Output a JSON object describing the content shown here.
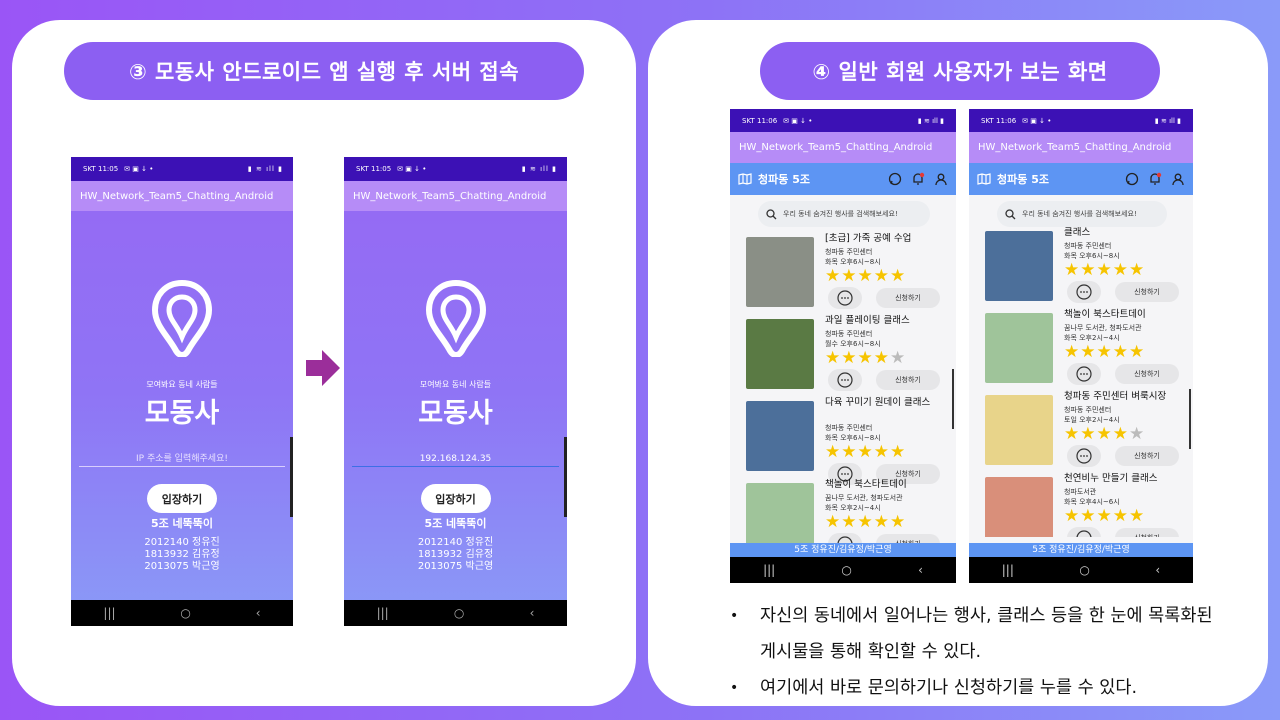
{
  "left_panel": {
    "heading": "③ 모동사 안드로이드 앱 실행 후 서버 접속",
    "phones": [
      {
        "status_time": "SKT 11:05",
        "app_title": "HW_Network_Team5_Chatting_Android",
        "tagline": "모여봐요 동네 사람들",
        "app_name": "모동사",
        "ip_input": "",
        "ip_placeholder": "IP 주소를 입력해주세요!",
        "enter_button": "입장하기",
        "team_name": "5조 네뚝뚝이",
        "members": [
          "2012140 정유진",
          "1813932 김유정",
          "2013075 박근영"
        ]
      },
      {
        "status_time": "SKT 11:05",
        "app_title": "HW_Network_Team5_Chatting_Android",
        "tagline": "모여봐요 동네 사람들",
        "app_name": "모동사",
        "ip_input": "192.168.124.35",
        "ip_placeholder": "",
        "enter_button": "입장하기",
        "team_name": "5조 네뚝뚝이",
        "members": [
          "2012140 정유진",
          "1813932 김유정",
          "2013075 박근영"
        ]
      }
    ]
  },
  "right_panel": {
    "heading": "④ 일반 회원 사용자가 보는 화면",
    "phones": [
      {
        "status_time": "SKT 11:06",
        "app_title": "HW_Network_Team5_Chatting_Android",
        "location": "청파동 5조",
        "search_placeholder": "우리 동네 숨겨진 행사를 검색해보세요!",
        "items": [
          {
            "title": "[초급] 가죽 공예 수업",
            "place": "청파동 주민센터",
            "time": "화목 오후6시~8시",
            "rating": 5,
            "apply": "신청하기",
            "thumb_color": "#8a8f86"
          },
          {
            "title": "과일 플레이팅 클래스",
            "place": "청파동 주민센터",
            "time": "월수 오후6시~8시",
            "rating": 4,
            "apply": "신청하기",
            "thumb_color": "#5a7a44"
          },
          {
            "title": "다육 꾸미기 원데이 클래스",
            "place": "청파동 주민센터",
            "time": "화목 오후6시~8시",
            "rating": 5,
            "apply": "신청하기",
            "thumb_color": "#4c6f9a"
          },
          {
            "title": "책놀이 북스타트데이",
            "place": "꿈나무 도서관, 청파도서관",
            "time": "화목 오후2시~4시",
            "rating": 5,
            "apply": "신청하기",
            "thumb_color": "#9fc49a"
          }
        ],
        "footer": "5조 정유진/김유정/박근영"
      },
      {
        "status_time": "SKT 11:06",
        "app_title": "HW_Network_Team5_Chatting_Android",
        "location": "청파동 5조",
        "search_placeholder": "우리 동네 숨겨진 행사를 검색해보세요!",
        "items": [
          {
            "title": "클래스",
            "place": "청파동 주민센터",
            "time": "화목 오후6시~8시",
            "rating": 5,
            "apply": "신청하기",
            "thumb_color": "#4c6f9a"
          },
          {
            "title": "책놀이 북스타트데이",
            "place": "꿈나무 도서관, 청파도서관",
            "time": "화목 오후2시~4시",
            "rating": 5,
            "apply": "신청하기",
            "thumb_color": "#9fc49a"
          },
          {
            "title": "청파동 주민센터 벼룩시장",
            "place": "청파동 주민센터",
            "time": "토일 오후2시~4시",
            "rating": 4,
            "apply": "신청하기",
            "thumb_color": "#e8d48a"
          },
          {
            "title": "천연비누 만들기 클래스",
            "place": "청파도서관",
            "time": "화목 오후4시~6시",
            "rating": 5,
            "apply": "신청하기",
            "thumb_color": "#d98f7a"
          }
        ],
        "footer": "5조 정유진/김유정/박근영"
      }
    ],
    "bullets": [
      "자신의 동네에서 일어나는 행사, 클래스 등을 한 눈에 목록화된 게시물을 통해 확인할 수 있다.",
      "여기에서 바로 문의하기나 신청하기를 누를 수 있다."
    ]
  },
  "colors": {
    "accent_purple": "#8c5ff2",
    "status_bar": "#3c11b5",
    "app_bar": "#b68cf7",
    "top_bar_blue": "#5d95f3",
    "star": "#f6c400",
    "arrow": "#9b2e9a"
  },
  "icons": [
    "map-icon",
    "chat-icon",
    "bell-icon",
    "user-icon",
    "search-icon",
    "location-pin-logo"
  ]
}
